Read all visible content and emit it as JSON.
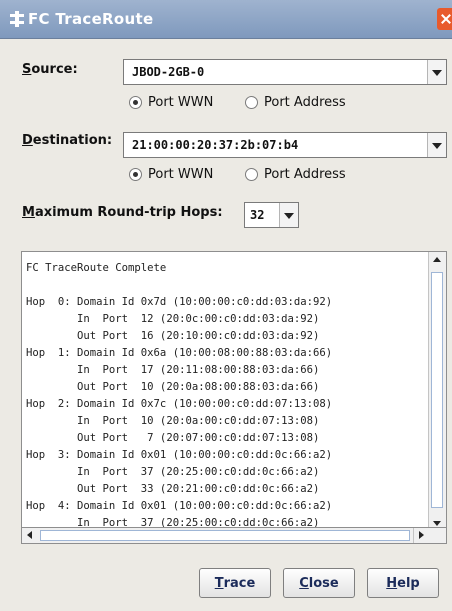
{
  "window": {
    "title": "FC TraceRoute"
  },
  "source": {
    "label_mnemonic": "S",
    "label_rest": "ource:",
    "value": "JBOD-2GB-0",
    "radio_wwn": "Port WWN",
    "radio_address": "Port Address",
    "selected": "wwn"
  },
  "destination": {
    "label_mnemonic": "D",
    "label_rest": "estination:",
    "value": "21:00:00:20:37:2b:07:b4",
    "radio_wwn": "Port WWN",
    "radio_address": "Port Address",
    "selected": "wwn"
  },
  "hops": {
    "label_mnemonic": "M",
    "label_rest": "aximum Round-trip Hops:",
    "value": "32"
  },
  "output": {
    "text": "FC TraceRoute Complete\n\nHop  0: Domain Id 0x7d (10:00:00:c0:dd:03:da:92)\n        In  Port  12 (20:0c:00:c0:dd:03:da:92)\n        Out Port  16 (20:10:00:c0:dd:03:da:92)\nHop  1: Domain Id 0x6a (10:00:08:00:88:03:da:66)\n        In  Port  17 (20:11:08:00:88:03:da:66)\n        Out Port  10 (20:0a:08:00:88:03:da:66)\nHop  2: Domain Id 0x7c (10:00:00:c0:dd:07:13:08)\n        In  Port  10 (20:0a:00:c0:dd:07:13:08)\n        Out Port   7 (20:07:00:c0:dd:07:13:08)\nHop  3: Domain Id 0x01 (10:00:00:c0:dd:0c:66:a2)\n        In  Port  37 (20:25:00:c0:dd:0c:66:a2)\n        Out Port  33 (20:21:00:c0:dd:0c:66:a2)\nHop  4: Domain Id 0x01 (10:00:00:c0:dd:0c:66:a2)\n        In  Port  37 (20:25:00:c0:dd:0c:66:a2)"
  },
  "buttons": {
    "trace": {
      "mnemonic": "T",
      "rest": "race"
    },
    "close": {
      "mnemonic": "C",
      "rest": "lose"
    },
    "help": {
      "mnemonic": "H",
      "rest": "elp"
    }
  },
  "colors": {
    "titlebar": "#8ea6c8",
    "close": "#e85a2c",
    "dialog_bg": "#eceae4"
  }
}
